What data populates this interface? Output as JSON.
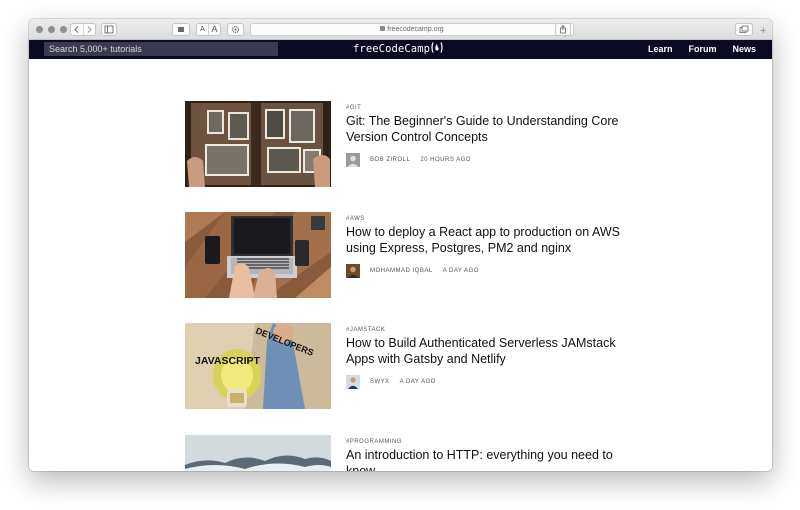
{
  "browser": {
    "url": "freecodecamp.org"
  },
  "site": {
    "search_placeholder": "Search 5,000+ tutorials",
    "logo_text": "freeCodeCamp",
    "nav": [
      "Learn",
      "Forum",
      "News"
    ],
    "colors": {
      "nav_bg": "#0a0a23",
      "search_bg": "#3b3b4f"
    }
  },
  "posts": [
    {
      "tag": "#GIT",
      "title": "Git: The Beginner's Guide to Understanding Core Version Control Concepts",
      "author": "BOB ZIROLL",
      "time": "20 HOURS AGO",
      "image": "photo-album"
    },
    {
      "tag": "#AWS",
      "title": "How to deploy a React app to production on AWS using Express, Postgres, PM2 and nginx",
      "author": "MOHAMMAD IQBAL",
      "time": "A DAY AGO",
      "image": "laptop-desk"
    },
    {
      "tag": "#JAMSTACK",
      "title": "How to Build Authenticated Serverless JAMstack Apps with Gatsby and Netlify",
      "author": "SWYX",
      "time": "A DAY AGO",
      "image": "javascript-developers",
      "image_text": [
        "JAVASCRIPT",
        "DEVELOPERS"
      ]
    },
    {
      "tag": "#PROGRAMMING",
      "title": "An introduction to HTTP: everything you need to know",
      "image": "mountain"
    }
  ]
}
